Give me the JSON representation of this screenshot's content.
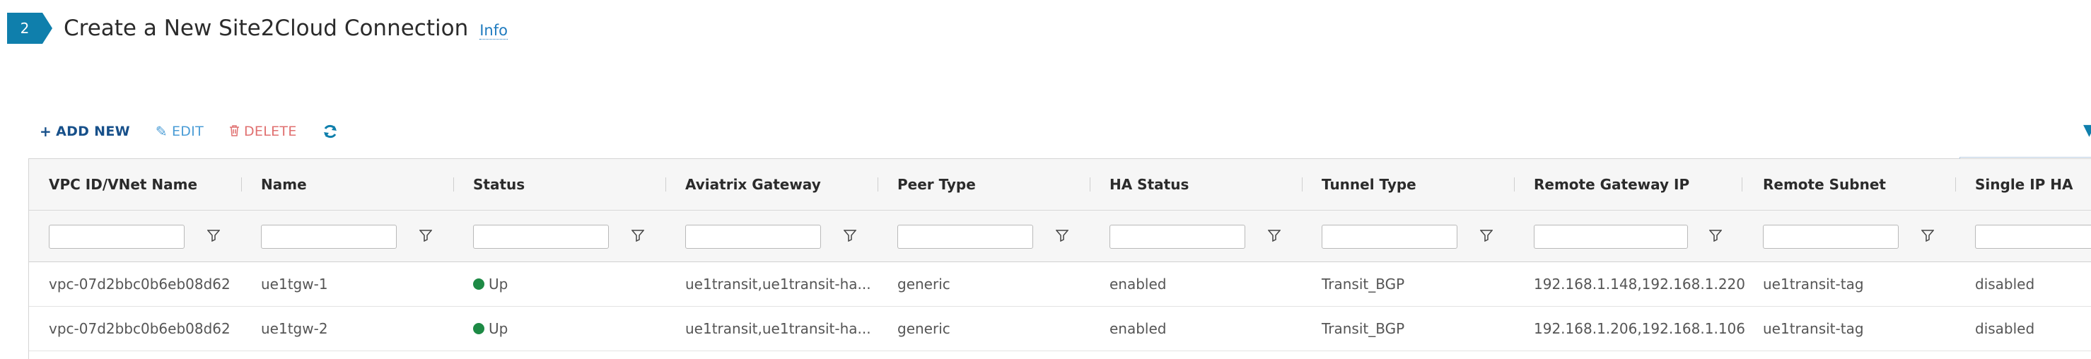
{
  "step": {
    "number": "2",
    "title": "Create a New Site2Cloud Connection",
    "info_label": "Info"
  },
  "toolbar": {
    "add_label": "ADD NEW",
    "edit_label": "EDIT",
    "delete_label": "DELETE",
    "add_icon": "plus-icon",
    "edit_icon": "pencil-icon",
    "delete_icon": "trash-icon",
    "refresh_icon": "refresh-icon"
  },
  "table": {
    "columns": [
      "VPC ID/VNet Name",
      "Name",
      "Status",
      "Aviatrix Gateway",
      "Peer Type",
      "HA Status",
      "Tunnel Type",
      "Remote Gateway IP",
      "Remote Subnet",
      "Single IP HA"
    ],
    "rows": [
      [
        "vpc-07d2bbc0b6eb08d62",
        "ue1tgw-1",
        "Up",
        "ue1transit,ue1transit-ha...",
        "generic",
        "enabled",
        "Transit_BGP",
        "192.168.1.148,192.168.1.220",
        "ue1transit-tag",
        "disabled"
      ],
      [
        "vpc-07d2bbc0b6eb08d62",
        "ue1tgw-2",
        "Up",
        "ue1transit,ue1transit-ha...",
        "generic",
        "enabled",
        "Transit_BGP",
        "192.168.1.206,192.168.1.106",
        "ue1transit-tag",
        "disabled"
      ]
    ]
  },
  "colors": {
    "accent": "#0f7fac",
    "status_up": "#1d8a45",
    "delete": "#e07070"
  }
}
